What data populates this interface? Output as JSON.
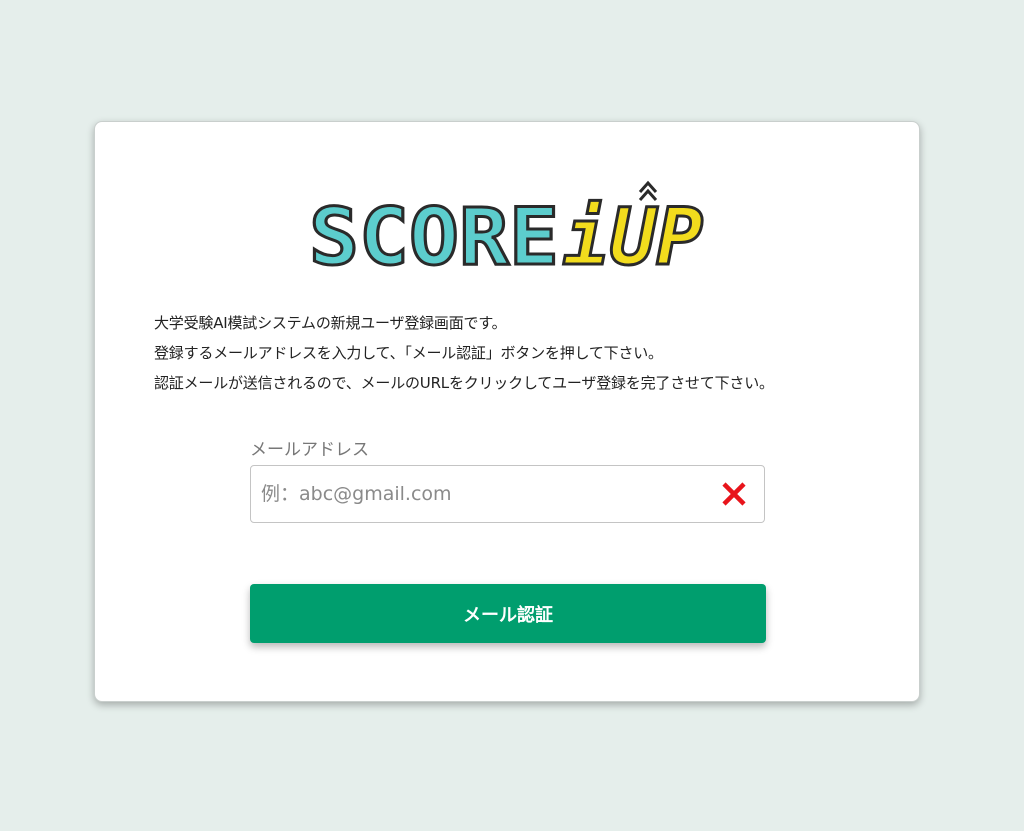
{
  "brand": {
    "logo_text_part1": "SCORE",
    "logo_text_part2": "iUP",
    "accent_teal": "#5ccdcd",
    "accent_yellow": "#f2dc1d",
    "outline": "#2a2a2a"
  },
  "description": {
    "line1": "大学受験AI模試システムの新規ユーザ登録画面です。",
    "line2": "登録するメールアドレスを入力して、「メール認証」ボタンを押して下さい。",
    "line3": "認証メールが送信されるので、メールのURLをクリックしてユーザ登録を完了させて下さい。"
  },
  "email_field": {
    "label": "メールアドレス",
    "placeholder": "例：abc@gmail.com",
    "value": "",
    "clear_icon": "close-icon",
    "clear_color": "#e8141b"
  },
  "submit": {
    "label": "メール認証",
    "color": "#009e6e"
  }
}
